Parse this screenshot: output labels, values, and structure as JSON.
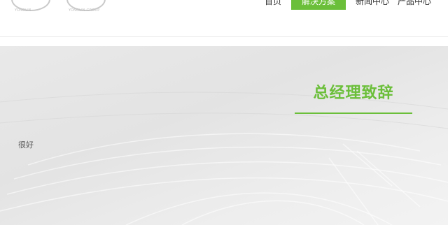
{
  "header": {
    "logos": [
      {
        "text": "YONGLIN"
      },
      {
        "text": "YONGLIN GROUP"
      }
    ],
    "nav": [
      {
        "label": "首页",
        "active": false
      },
      {
        "label": "解决方案",
        "active": true
      },
      {
        "label": "新闻中心",
        "active": false
      },
      {
        "label": "产品中心",
        "active": false
      }
    ]
  },
  "main": {
    "title": "总经理致辞",
    "message": "很好"
  },
  "colors": {
    "accent": "#6bbf3a",
    "hero_background": "#e6e6e6"
  }
}
